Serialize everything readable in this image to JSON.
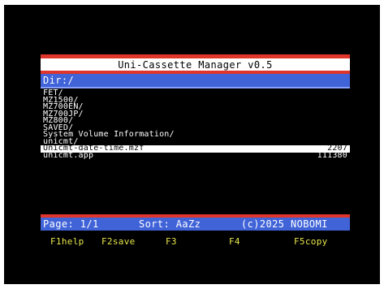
{
  "colors": {
    "screen_background": "#000000",
    "title_border": "#e0352b",
    "accent_blue": "#4063d8",
    "list_text": "#ffffff",
    "function_key_text": "#e6e64a"
  },
  "header": {
    "title": "Uni-Cassette Manager v0.5",
    "directory": "Dir:/"
  },
  "files": [
    {
      "name": "FET/",
      "size": ""
    },
    {
      "name": "MZ1500/",
      "size": ""
    },
    {
      "name": "MZ700EN/",
      "size": ""
    },
    {
      "name": "MZ700JP/",
      "size": ""
    },
    {
      "name": "MZ800/",
      "size": ""
    },
    {
      "name": "SAVED/",
      "size": ""
    },
    {
      "name": "System Volume Information/",
      "size": ""
    },
    {
      "name": "unicmt/",
      "size": ""
    },
    {
      "name": "Unicmt-date-time.mzf",
      "size": "2207",
      "selected": true
    },
    {
      "name": "unicmt.app",
      "size": "111380"
    }
  ],
  "status": {
    "page": "Page: 1/1",
    "sort": "Sort: AaZz",
    "copyright": "(c)2025 NOBOMI"
  },
  "function_keys": [
    "F1help",
    "F2save",
    "F3",
    "F4",
    "F5copy"
  ]
}
